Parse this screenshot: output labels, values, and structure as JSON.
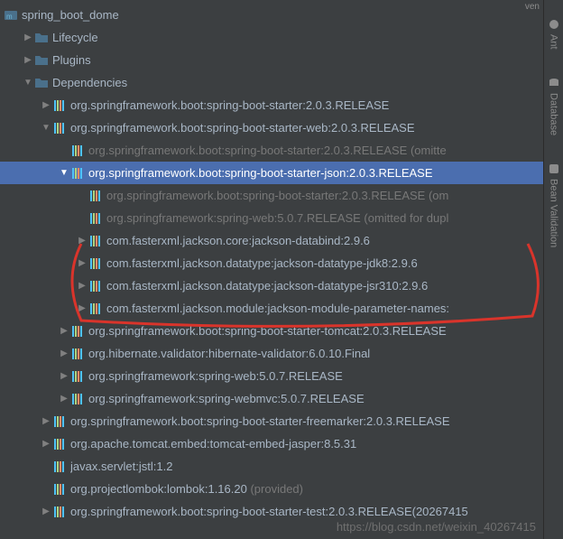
{
  "top_tab": "ven",
  "project_name": "spring_boot_dome",
  "sidebar_tools": [
    "Ant",
    "Database",
    "Bean Validation"
  ],
  "tree": {
    "root_folders": [
      "Lifecycle",
      "Plugins",
      "Dependencies"
    ],
    "deps": [
      {
        "label": "org.springframework.boot:spring-boot-starter:2.0.3.RELEASE",
        "arrow": "right"
      },
      {
        "label": "org.springframework.boot:spring-boot-starter-web:2.0.3.RELEASE",
        "arrow": "down",
        "underlined_part": "ework.boot:spring-boot-starter-web:2.0.3.RELEASE"
      },
      {
        "label": "org.springframework.boot:spring-boot-starter-freemarker:2.0.3.RELEASE",
        "arrow": "right"
      },
      {
        "label": "org.apache.tomcat.embed:tomcat-embed-jasper:8.5.31",
        "arrow": "right"
      },
      {
        "label": "javax.servlet:jstl:1.2",
        "arrow": "none"
      },
      {
        "label": "org.projectlombok:lombok:1.16.20",
        "suffix": " (provided)",
        "arrow": "none"
      },
      {
        "label": "org.springframework.boot:spring-boot-starter-test:2.0.3.RELEASE(20267415",
        "arrow": "right"
      }
    ],
    "web_children": [
      {
        "label": "org.springframework.boot:spring-boot-starter:2.0.3.RELEASE (omitte",
        "dimmed": true,
        "arrow": "none"
      },
      {
        "label": "org.springframework.boot:spring-boot-starter-json:2.0.3.RELEASE",
        "arrow": "down",
        "selected": true
      },
      {
        "label": "org.springframework.boot:spring-boot-starter-tomcat:2.0.3.RELEASE",
        "arrow": "right"
      },
      {
        "label": "org.hibernate.validator:hibernate-validator:6.0.10.Final",
        "arrow": "right"
      },
      {
        "label": "org.springframework:spring-web:5.0.7.RELEASE",
        "arrow": "right"
      },
      {
        "label": "org.springframework:spring-webmvc:5.0.7.RELEASE",
        "arrow": "right"
      }
    ],
    "json_children": [
      {
        "label": "org.springframework.boot:spring-boot-starter:2.0.3.RELEASE (om",
        "dimmed": true,
        "arrow": "none"
      },
      {
        "label": "org.springframework:spring-web:5.0.7.RELEASE (omitted for dupl",
        "dimmed": true,
        "arrow": "none"
      },
      {
        "label": "com.fasterxml.jackson.core:jackson-databind:2.9.6",
        "arrow": "right"
      },
      {
        "label": "com.fasterxml.jackson.datatype:jackson-datatype-jdk8:2.9.6",
        "arrow": "right"
      },
      {
        "label": "com.fasterxml.jackson.datatype:jackson-datatype-jsr310:2.9.6",
        "arrow": "right"
      },
      {
        "label": "com.fasterxml.jackson.module:jackson-module-parameter-names:",
        "arrow": "right"
      }
    ]
  },
  "watermark": "https://blog.csdn.net/weixin_40267415"
}
